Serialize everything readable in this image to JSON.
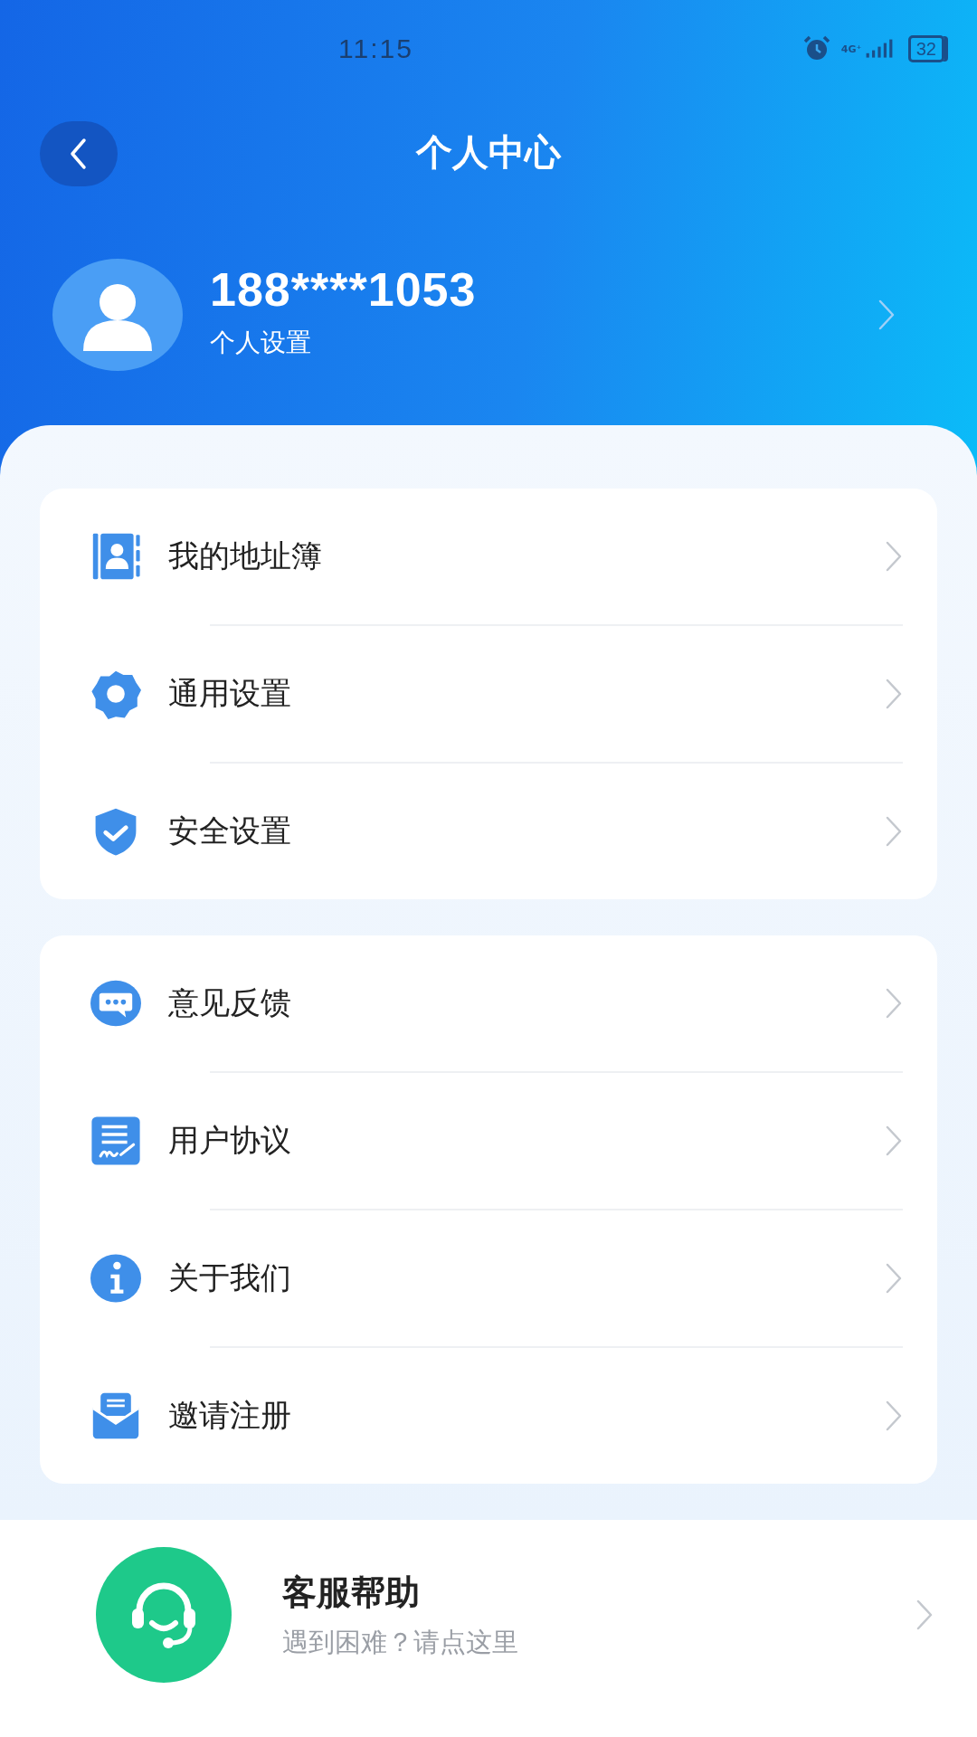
{
  "status_bar": {
    "time": "11:15",
    "network": "4G⁺",
    "battery": "32"
  },
  "header": {
    "title": "个人中心"
  },
  "profile": {
    "phone": "188****1053",
    "subtitle": "个人设置"
  },
  "menu_groups": [
    {
      "items": [
        {
          "label": "我的地址簿"
        },
        {
          "label": "通用设置"
        },
        {
          "label": "安全设置"
        }
      ]
    },
    {
      "items": [
        {
          "label": "意见反馈"
        },
        {
          "label": "用户协议"
        },
        {
          "label": "关于我们"
        },
        {
          "label": "邀请注册"
        }
      ]
    }
  ],
  "support": {
    "title": "客服帮助",
    "subtitle": "遇到困难？请点这里"
  }
}
